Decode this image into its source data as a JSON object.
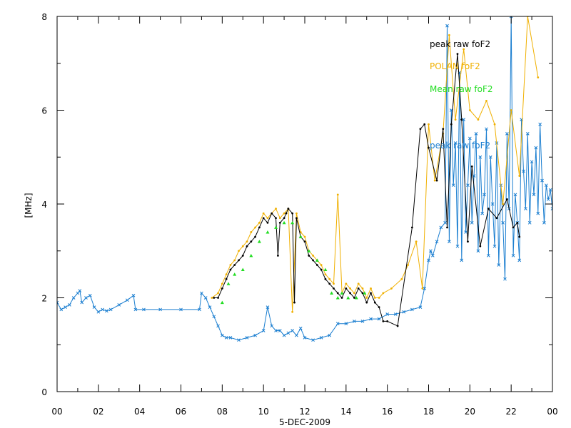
{
  "chart_data": {
    "type": "line",
    "title": "",
    "xlabel": "5-DEC-2009",
    "ylabel": "[MHz]",
    "xlim": [
      0,
      24
    ],
    "ylim": [
      0,
      8
    ],
    "x_ticks": [
      "00",
      "02",
      "04",
      "06",
      "08",
      "10",
      "12",
      "14",
      "16",
      "18",
      "20",
      "22",
      "00"
    ],
    "y_ticks": [
      "0",
      "2",
      "4",
      "6",
      "8"
    ],
    "grid": false,
    "legend_position": "top-right",
    "series": [
      {
        "name": "peak raw foF2",
        "color": "#000000",
        "marker": "dot",
        "x": [
          7.6,
          7.8,
          8.0,
          8.2,
          8.4,
          8.6,
          8.8,
          9.0,
          9.2,
          9.4,
          9.6,
          9.8,
          10.0,
          10.2,
          10.4,
          10.6,
          10.7,
          10.8,
          11.0,
          11.1,
          11.2,
          11.4,
          11.5,
          11.6,
          11.8,
          12.0,
          12.2,
          12.4,
          12.6,
          12.8,
          13.0,
          13.2,
          13.4,
          13.6,
          13.8,
          14.0,
          14.2,
          14.4,
          14.6,
          14.8,
          15.0,
          15.2,
          15.4,
          15.6,
          15.8,
          16.0,
          16.5,
          17.2,
          17.6,
          17.8,
          18.0,
          18.4,
          18.7,
          18.9,
          19.1,
          19.4,
          19.6,
          19.9,
          20.1,
          20.5,
          20.9,
          21.3,
          21.8,
          22.1,
          22.3,
          22.4
        ],
        "y": [
          2.0,
          2.0,
          2.2,
          2.4,
          2.6,
          2.7,
          2.8,
          2.9,
          3.1,
          3.2,
          3.3,
          3.5,
          3.7,
          3.6,
          3.8,
          3.7,
          2.9,
          3.6,
          3.7,
          3.8,
          3.9,
          3.8,
          1.9,
          3.7,
          3.3,
          3.2,
          2.9,
          2.8,
          2.7,
          2.6,
          2.4,
          2.3,
          2.2,
          2.1,
          2.0,
          2.2,
          2.1,
          2.0,
          2.2,
          2.1,
          1.9,
          2.1,
          1.9,
          1.8,
          1.5,
          1.5,
          1.4,
          3.5,
          5.6,
          5.7,
          5.2,
          4.5,
          5.6,
          3.5,
          5.7,
          7.2,
          5.8,
          3.2,
          4.8,
          3.1,
          3.9,
          3.7,
          4.1,
          3.5,
          3.6,
          3.3
        ]
      },
      {
        "name": "POLAN foF2",
        "color": "#f0b000",
        "marker": "dot",
        "x": [
          7.5,
          7.8,
          8.0,
          8.2,
          8.4,
          8.6,
          8.8,
          9.0,
          9.2,
          9.4,
          9.6,
          9.8,
          10.0,
          10.2,
          10.4,
          10.6,
          10.8,
          11.0,
          11.2,
          11.4,
          11.6,
          11.8,
          12.0,
          12.2,
          12.4,
          12.6,
          12.8,
          13.0,
          13.2,
          13.4,
          13.6,
          13.8,
          14.0,
          14.2,
          14.4,
          14.6,
          14.8,
          15.0,
          15.2,
          15.4,
          15.6,
          15.8,
          16.2,
          16.7,
          17.0,
          17.4,
          17.7,
          18.0,
          18.3,
          18.7,
          19.0,
          19.3,
          19.7,
          20.0,
          20.4,
          20.8,
          21.2,
          21.6,
          22.0,
          22.4,
          22.8,
          23.3
        ],
        "y": [
          2.0,
          2.1,
          2.3,
          2.5,
          2.7,
          2.8,
          3.0,
          3.1,
          3.2,
          3.4,
          3.5,
          3.6,
          3.8,
          3.7,
          3.8,
          3.9,
          3.7,
          3.8,
          3.9,
          1.7,
          3.8,
          3.4,
          3.3,
          3.0,
          2.9,
          2.8,
          2.7,
          2.5,
          2.4,
          2.3,
          4.2,
          2.1,
          2.3,
          2.2,
          2.1,
          2.3,
          2.2,
          2.0,
          2.2,
          2.0,
          2.0,
          2.1,
          2.2,
          2.4,
          2.7,
          3.2,
          2.2,
          5.7,
          4.5,
          5.5,
          7.6,
          5.8,
          7.3,
          6.0,
          5.8,
          6.2,
          5.7,
          4.0,
          6.0,
          4.6,
          8.0,
          6.7
        ]
      },
      {
        "name": "Mean raw foF2",
        "color": "#22dd22",
        "marker": "triangle",
        "x": [
          8.0,
          8.3,
          8.6,
          9.0,
          9.4,
          9.8,
          10.2,
          10.6,
          11.0,
          11.4,
          11.8,
          12.2,
          12.6,
          13.0,
          13.3,
          13.6,
          13.8,
          14.1,
          14.5,
          14.9
        ],
        "y": [
          1.9,
          2.3,
          2.5,
          2.6,
          2.9,
          3.2,
          3.4,
          3.5,
          3.6,
          3.6,
          3.3,
          3.0,
          2.8,
          2.6,
          2.1,
          2.0,
          2.1,
          2.0,
          2.0,
          2.1
        ]
      },
      {
        "name": "peak raw foF2",
        "color": "#1a7ed0",
        "marker": "cross",
        "x": [
          0.0,
          0.2,
          0.4,
          0.6,
          0.8,
          1.0,
          1.1,
          1.2,
          1.4,
          1.6,
          1.8,
          2.0,
          2.2,
          2.4,
          2.6,
          3.0,
          3.4,
          3.7,
          3.8,
          4.2,
          5.0,
          6.0,
          6.9,
          7.0,
          7.2,
          7.4,
          7.6,
          7.8,
          8.0,
          8.2,
          8.4,
          8.8,
          9.2,
          9.6,
          10.0,
          10.2,
          10.4,
          10.6,
          10.8,
          11.0,
          11.2,
          11.4,
          11.6,
          11.8,
          12.0,
          12.4,
          12.8,
          13.2,
          13.6,
          14.0,
          14.4,
          14.8,
          15.2,
          15.6,
          16.0,
          16.4,
          16.8,
          17.2,
          17.6,
          17.8,
          18.0,
          18.1,
          18.2,
          18.4,
          18.6,
          18.8,
          18.9,
          19.0,
          19.1,
          19.2,
          19.3,
          19.4,
          19.5,
          19.6,
          19.7,
          19.8,
          19.9,
          20.0,
          20.1,
          20.2,
          20.3,
          20.4,
          20.5,
          20.6,
          20.7,
          20.8,
          20.9,
          21.0,
          21.1,
          21.2,
          21.3,
          21.4,
          21.5,
          21.6,
          21.7,
          21.8,
          21.9,
          22.0,
          22.1,
          22.2,
          22.3,
          22.4,
          22.5,
          22.6,
          22.7,
          22.8,
          22.9,
          23.0,
          23.1,
          23.2,
          23.3,
          23.4,
          23.5,
          23.6,
          23.7,
          23.8,
          23.9,
          24.0
        ],
        "y": [
          1.9,
          1.75,
          1.8,
          1.85,
          2.0,
          2.1,
          2.15,
          1.9,
          2.0,
          2.05,
          1.8,
          1.7,
          1.75,
          1.72,
          1.75,
          1.85,
          1.95,
          2.05,
          1.75,
          1.75,
          1.75,
          1.75,
          1.75,
          2.1,
          2.0,
          1.8,
          1.6,
          1.4,
          1.2,
          1.15,
          1.15,
          1.1,
          1.15,
          1.2,
          1.3,
          1.8,
          1.4,
          1.3,
          1.3,
          1.2,
          1.25,
          1.3,
          1.2,
          1.35,
          1.15,
          1.1,
          1.15,
          1.2,
          1.45,
          1.45,
          1.5,
          1.5,
          1.55,
          1.55,
          1.65,
          1.65,
          1.7,
          1.75,
          1.8,
          2.2,
          2.8,
          3.0,
          2.9,
          3.2,
          3.5,
          3.6,
          7.8,
          3.2,
          6.0,
          4.4,
          5.3,
          3.1,
          6.8,
          2.8,
          5.8,
          3.4,
          4.4,
          5.4,
          3.6,
          4.6,
          5.5,
          3.0,
          5.0,
          3.8,
          4.2,
          5.6,
          2.9,
          5.0,
          4.0,
          3.1,
          5.3,
          2.7,
          4.4,
          3.6,
          2.4,
          5.5,
          3.9,
          8.0,
          2.9,
          4.2,
          3.6,
          2.8,
          5.8,
          4.7,
          3.9,
          5.5,
          3.6,
          4.9,
          4.2,
          5.2,
          3.8,
          5.7,
          4.5,
          3.6,
          4.4,
          4.1,
          4.3,
          3.9
        ]
      }
    ],
    "annotations": []
  }
}
